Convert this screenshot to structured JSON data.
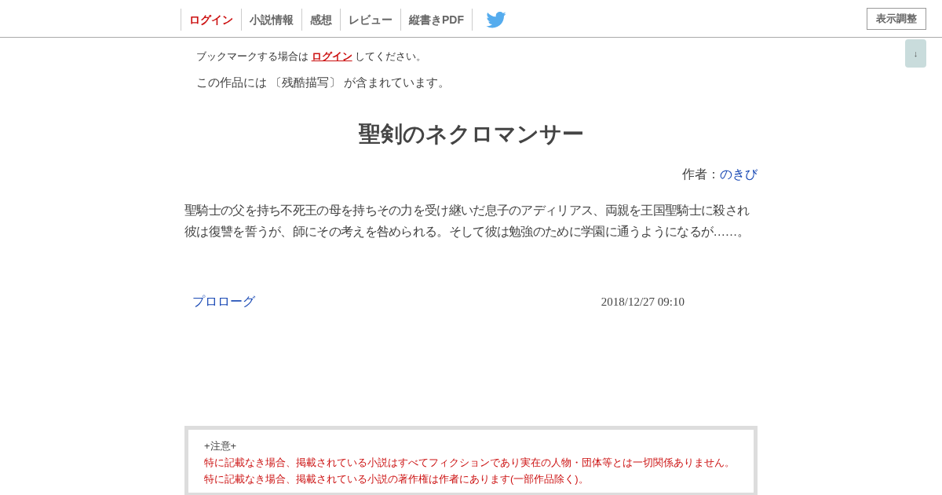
{
  "nav": {
    "items": [
      {
        "label": "ログイン",
        "kind": "login"
      },
      {
        "label": "小説情報",
        "kind": "normal"
      },
      {
        "label": "感想",
        "kind": "normal"
      },
      {
        "label": "レビュー",
        "kind": "normal"
      },
      {
        "label": "縦書きPDF",
        "kind": "normal"
      }
    ],
    "display_button": "表示調整"
  },
  "scroll_button": "↓",
  "bookmark_notice": {
    "before": "ブックマークする場合は",
    "link": "ログイン",
    "after": "してください。"
  },
  "content_warning": "この作品には 〔残酷描写〕 が含まれています。",
  "title": "聖剣のネクロマンサー",
  "author": {
    "label": "作者：",
    "name": "のきび"
  },
  "synopsis": "聖騎士の父を持ち不死王の母を持ちその力を受け継いだ息子のアディリアス、両親を王国聖騎士に殺され彼は復讐を誓うが、師にその考えを咎められる。そして彼は勉強のために学園に通うようになるが……。",
  "chapters": [
    {
      "title": "プロローグ",
      "date": "2018/12/27 09:10"
    }
  ],
  "notice": {
    "heading": "+注意+",
    "lines": [
      "特に記載なき場合、掲載されている小説はすべてフィクションであり実在の人物・団体等とは一切関係ありません。",
      "特に記載なき場合、掲載されている小説の著作権は作者にあります(一部作品除く)。"
    ]
  }
}
